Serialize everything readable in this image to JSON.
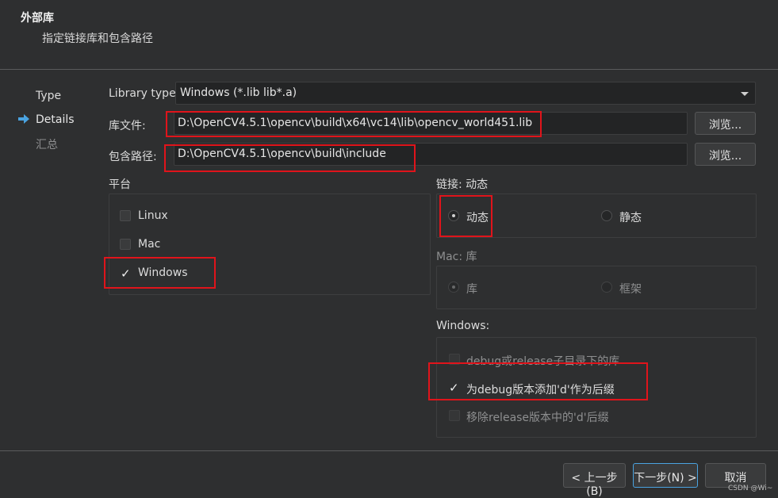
{
  "header": {
    "title": "外部库",
    "subtitle": "指定链接库和包含路径"
  },
  "sidebar": {
    "items": [
      {
        "label": "Type",
        "state": "done"
      },
      {
        "label": "Details",
        "state": "current"
      },
      {
        "label": "汇总",
        "state": "pending"
      }
    ]
  },
  "form": {
    "library_type_label": "Library type:",
    "library_type_value": "Windows (*.lib lib*.a)",
    "library_file_label": "库文件:",
    "library_file_value": "D:\\OpenCV4.5.1\\opencv\\build\\x64\\vc14\\lib\\opencv_world451.lib",
    "include_path_label": "包含路径:",
    "include_path_value": "D:\\OpenCV4.5.1\\opencv\\build\\include",
    "browse_label": "浏览..."
  },
  "platform": {
    "title": "平台",
    "options": [
      {
        "label": "Linux",
        "checked": false
      },
      {
        "label": "Mac",
        "checked": false
      },
      {
        "label": "Windows",
        "checked": true
      }
    ]
  },
  "linking": {
    "title": "链接: 动态",
    "dynamic_label": "动态",
    "static_label": "静态",
    "selected": "dynamic"
  },
  "mac": {
    "title": "Mac: 库",
    "library_label": "库",
    "framework_label": "框架",
    "enabled": false
  },
  "windows": {
    "title": "Windows:",
    "debug_release_subdir_label": "debug或release子目录下的库",
    "debug_suffix_label": "为debug版本添加'd'作为后缀",
    "remove_release_suffix_label": "移除release版本中的'd'后缀",
    "debug_suffix_checked": true
  },
  "footer": {
    "prev_label": "< 上一步(B)",
    "next_label": "下一步(N) >",
    "cancel_label": "取消"
  },
  "check_glyph": "✓",
  "watermark": "CSDN @Wi~",
  "colors": {
    "background": "#2e2f30",
    "field_bg": "#232425",
    "highlight_red": "#e0141b",
    "arrow_blue": "#4aa3e0"
  }
}
